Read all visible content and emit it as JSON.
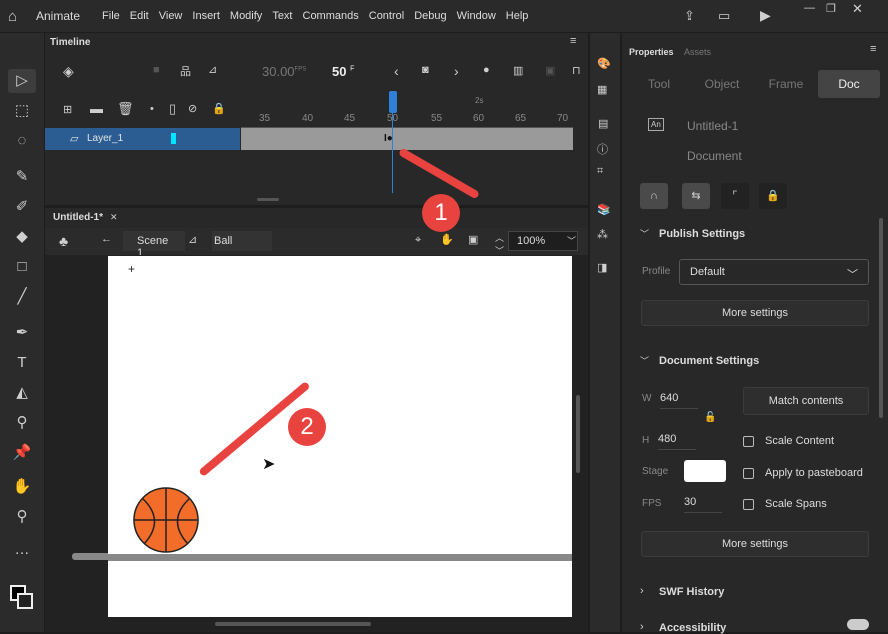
{
  "app": {
    "name": "Animate",
    "menu": [
      "File",
      "Edit",
      "View",
      "Insert",
      "Modify",
      "Text",
      "Commands",
      "Control",
      "Debug",
      "Window",
      "Help"
    ]
  },
  "timeline": {
    "title": "Timeline",
    "fps": "30.00",
    "fps_unit": "FPS",
    "frame": "50",
    "frame_unit": "F",
    "ruler_ticks": [
      "35",
      "40",
      "45",
      "50",
      "55",
      "60",
      "65",
      "70"
    ],
    "seconds_marker": "2s",
    "layer": "Layer_1",
    "layer_color": "#00e5ff"
  },
  "document": {
    "tab": "Untitled-1*",
    "scene": "Scene 1",
    "symbol": "Ball",
    "zoom": "100%"
  },
  "annotations": {
    "badge1": "1",
    "badge2": "2",
    "color": "#e8433f"
  },
  "properties": {
    "tabs": [
      "Properties",
      "Assets"
    ],
    "segments": [
      "Tool",
      "Object",
      "Frame",
      "Doc"
    ],
    "active_segment": "Doc",
    "doc_icon": "An",
    "doc_name": "Untitled-1",
    "doc_type": "Document",
    "publish": {
      "title": "Publish Settings",
      "profile_label": "Profile",
      "profile": "Default",
      "more": "More settings"
    },
    "docsettings": {
      "title": "Document Settings",
      "w_label": "W",
      "w": "640",
      "h_label": "H",
      "h": "480",
      "match": "Match contents",
      "stage_label": "Stage",
      "stage_color": "#ffffff",
      "fps_label": "FPS",
      "fps": "30",
      "scale_content": "Scale Content",
      "apply_pasteboard": "Apply to pasteboard",
      "scale_spans": "Scale Spans",
      "more": "More settings"
    },
    "swf_history": "SWF History",
    "accessibility": "Accessibility"
  }
}
